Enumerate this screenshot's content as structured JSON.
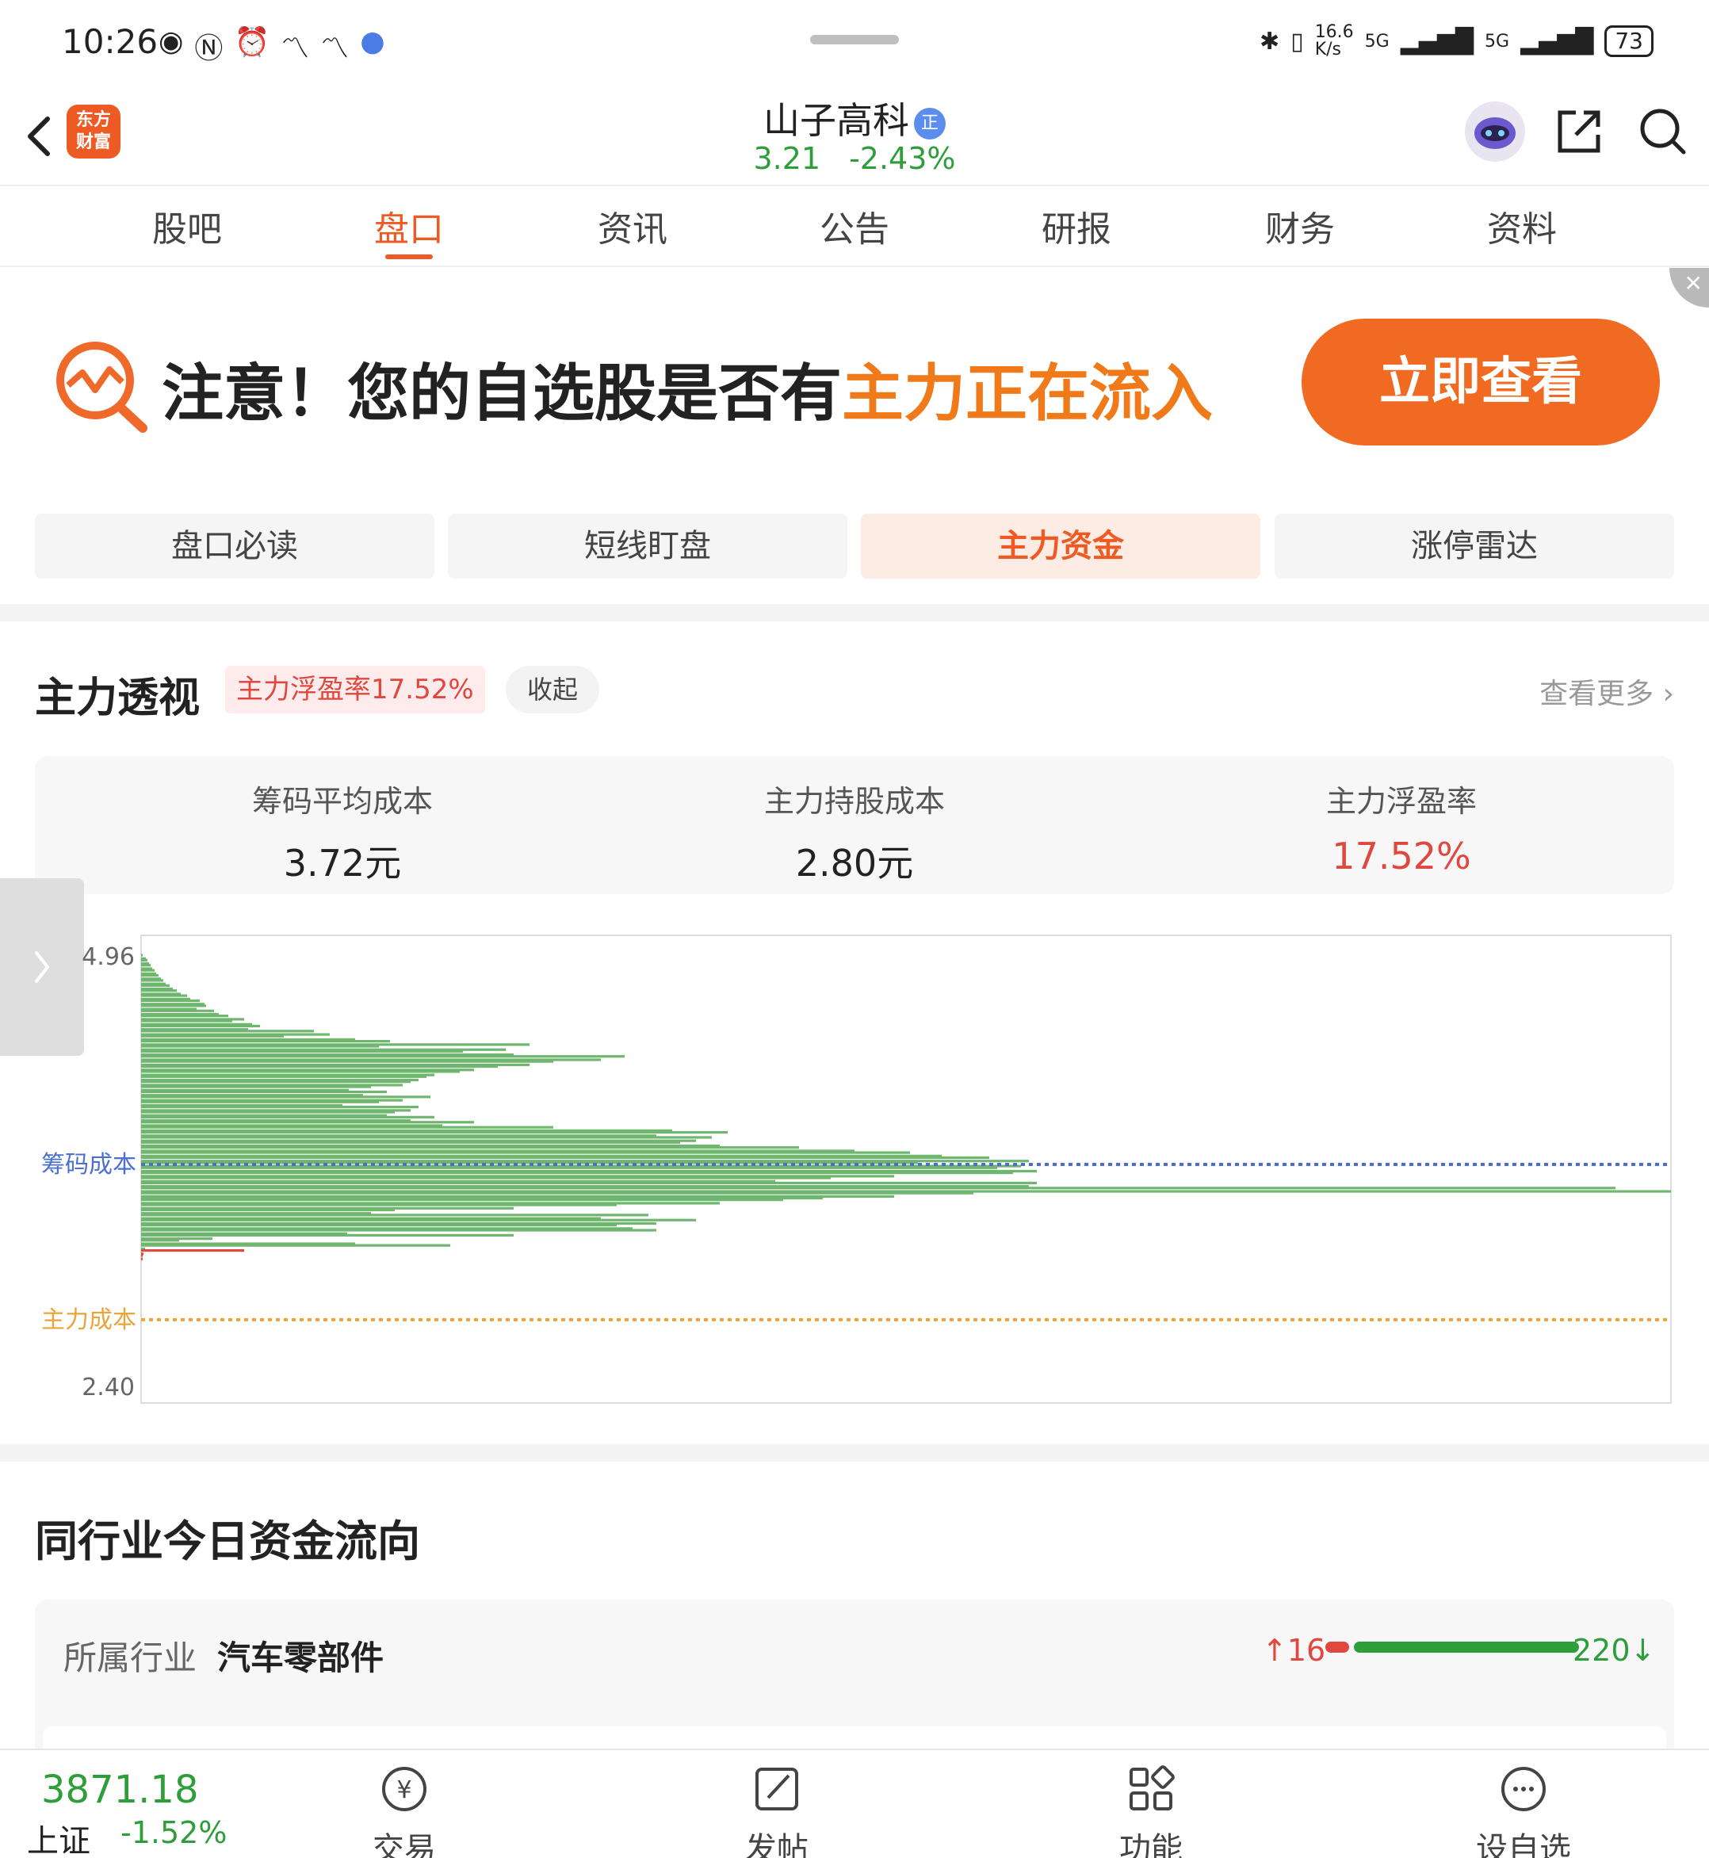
{
  "status_bar": {
    "time": "10:26",
    "net_speed": "16.6\nK/s",
    "signal1": "5G",
    "signal2": "5G",
    "battery": "73"
  },
  "header": {
    "logo_text": "东方\n财富",
    "stock_name": "山子高科",
    "badge": "正",
    "price": "3.21",
    "change": "-2.43%"
  },
  "tabs": [
    "股吧",
    "盘口",
    "资讯",
    "公告",
    "研报",
    "财务",
    "资料"
  ],
  "active_tab": "盘口",
  "banner": {
    "text_main": "注意！您的自选股是否有",
    "text_highlight": "主力正在流入",
    "button": "立即查看",
    "close": "✕"
  },
  "subtabs": [
    "盘口必读",
    "短线盯盘",
    "主力资金",
    "涨停雷达"
  ],
  "active_subtab": "主力资金",
  "panel": {
    "title": "主力透视",
    "tag": "主力浮盈率17.52%",
    "collapse": "收起",
    "more": "查看更多",
    "stats": [
      {
        "label": "筹码平均成本",
        "value": "3.72元"
      },
      {
        "label": "主力持股成本",
        "value": "2.80元"
      },
      {
        "label": "主力浮盈率",
        "value": "17.52%"
      }
    ]
  },
  "chart_data": {
    "type": "bar",
    "orientation": "horizontal",
    "y_top_label": "4.96",
    "y_bottom_label": "2.40",
    "ylim": [
      2.4,
      4.96
    ],
    "reference_lines": [
      {
        "name": "筹码成本",
        "value": 3.72,
        "color": "#4a6fd1"
      },
      {
        "name": "主力成本",
        "value": 2.8,
        "color": "#e8a63a"
      }
    ],
    "colors": {
      "profit": "#6fb66f",
      "loss": "#e0473f"
    },
    "series": [
      {
        "values": [
          4.96,
          2,
          4.94,
          6,
          4.93,
          8,
          4.91,
          10,
          4.9,
          12,
          4.88,
          14,
          4.87,
          17,
          4.85,
          19,
          4.84,
          22,
          4.82,
          25,
          4.81,
          28,
          4.79,
          31,
          4.78,
          36,
          4.76,
          40,
          4.75,
          45,
          4.73,
          50,
          4.72,
          58,
          4.7,
          62,
          4.69,
          74,
          4.67,
          80,
          4.66,
          82,
          4.64,
          70,
          4.63,
          92,
          4.61,
          98,
          4.6,
          110,
          4.58,
          130,
          4.57,
          115,
          4.55,
          140,
          4.54,
          150,
          4.52,
          135,
          4.51,
          218,
          4.49,
          238,
          4.48,
          180,
          4.46,
          270,
          4.45,
          314,
          4.43,
          490,
          4.42,
          300,
          4.4,
          460,
          4.39,
          406,
          4.37,
          470,
          4.36,
          610,
          4.34,
          580,
          4.33,
          520,
          4.31,
          490,
          4.3,
          450,
          4.28,
          420,
          4.27,
          402,
          4.25,
          370,
          4.24,
          360,
          4.22,
          350,
          4.21,
          340,
          4.19,
          330,
          4.18,
          290,
          4.16,
          262,
          4.15,
          310,
          4.13,
          280,
          4.12,
          365,
          4.1,
          330,
          4.09,
          300,
          4.07,
          254,
          4.06,
          350,
          4.04,
          340,
          4.03,
          320,
          4.01,
          310,
          4.0,
          370,
          3.98,
          340,
          3.97,
          420,
          3.95,
          380,
          3.94,
          520,
          3.92,
          670,
          3.91,
          740,
          3.89,
          650,
          3.88,
          720,
          3.86,
          700,
          3.85,
          680,
          3.83,
          730,
          3.82,
          830,
          3.8,
          900,
          3.79,
          970,
          3.77,
          1010,
          3.76,
          1070,
          3.74,
          1120,
          3.73,
          980,
          3.71,
          1110,
          3.7,
          1080,
          3.68,
          1130,
          3.67,
          1100,
          3.65,
          950,
          3.64,
          870,
          3.62,
          800,
          3.61,
          1130,
          3.59,
          1120,
          3.58,
          1860,
          3.56,
          1930,
          3.55,
          1050,
          3.53,
          950,
          3.52,
          860,
          3.51,
          810,
          3.49,
          730,
          3.48,
          600,
          3.46,
          470,
          3.45,
          320,
          3.43,
          290,
          3.42,
          640,
          3.4,
          580,
          3.39,
          700,
          3.37,
          650,
          3.36,
          600,
          3.34,
          620,
          3.33,
          650,
          3.31,
          260,
          3.3,
          470,
          3.28,
          90,
          3.27,
          48,
          3.25,
          270,
          3.24,
          390,
          3.22,
          5,
          3.21,
          130,
          3.19,
          3,
          3.18,
          2,
          3.16,
          2
        ]
      }
    ]
  },
  "industry": {
    "title": "同行业今日资金流向",
    "label": "所属行业",
    "name": "汽车零部件",
    "up_count": "16",
    "down_count": "220",
    "up_arrow": "↑",
    "down_arrow": "↓"
  },
  "bottom_bar": {
    "index_value": "3871.18",
    "index_name": "上证",
    "index_change": "-1.52%",
    "nav": [
      "交易",
      "发帖",
      "功能",
      "设自选"
    ]
  }
}
